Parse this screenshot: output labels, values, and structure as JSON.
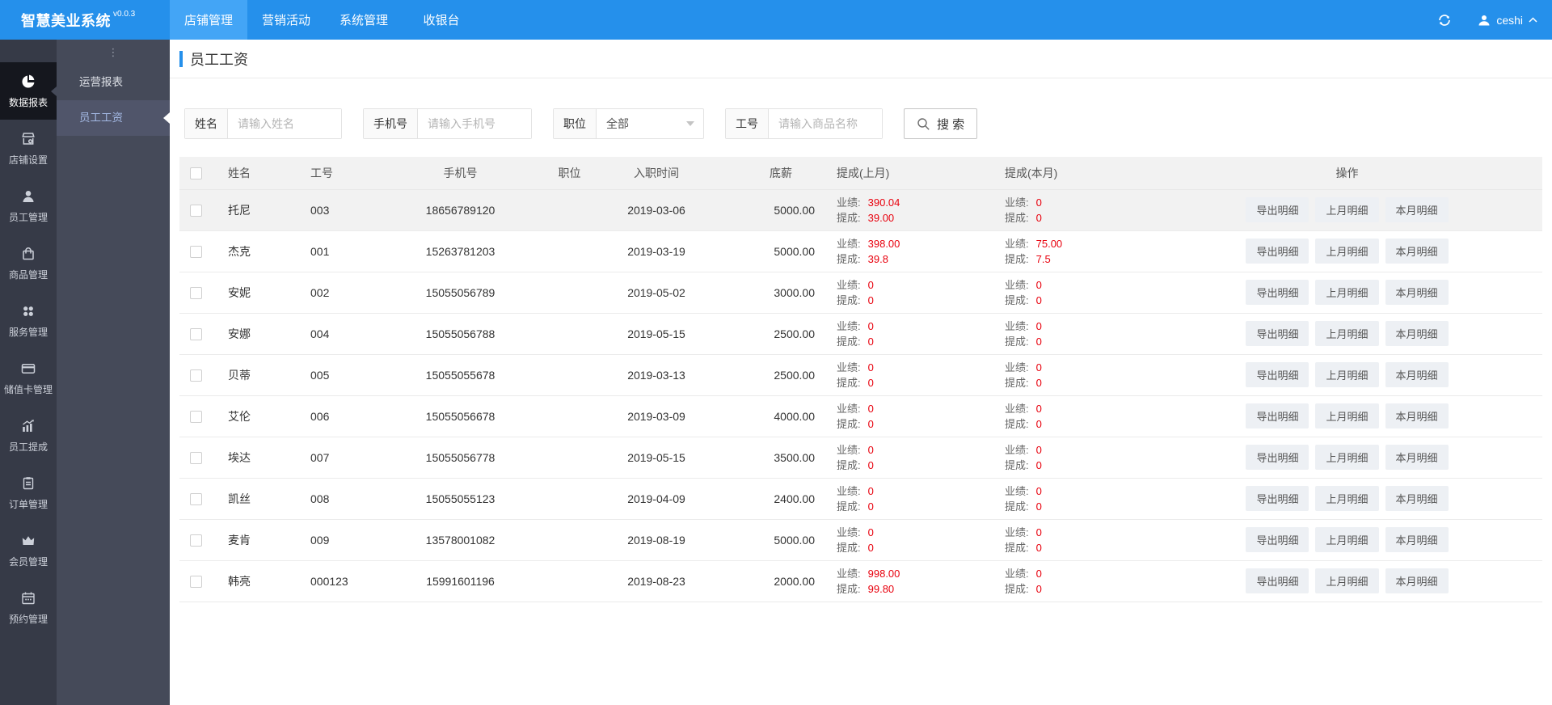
{
  "app": {
    "title": "智慧美业系统",
    "version": "v0.0.3"
  },
  "topnav": {
    "tabs": [
      {
        "label": "店铺管理",
        "slug": "store-management",
        "active": true
      },
      {
        "label": "营销活动",
        "slug": "marketing",
        "active": false
      },
      {
        "label": "系统管理",
        "slug": "system-management",
        "active": false
      },
      {
        "label": "收银台",
        "slug": "cashier",
        "active": false
      }
    ],
    "user": "ceshi"
  },
  "sidebar": {
    "items": [
      {
        "label": "数据报表",
        "icon": "pie-chart-icon",
        "slug": "data-reports",
        "active": true
      },
      {
        "label": "店铺设置",
        "icon": "storefront-icon",
        "slug": "store-settings",
        "active": false
      },
      {
        "label": "员工管理",
        "icon": "staff-icon",
        "slug": "staff-management",
        "active": false
      },
      {
        "label": "商品管理",
        "icon": "shopping-bag-icon",
        "slug": "goods-management",
        "active": false
      },
      {
        "label": "服务管理",
        "icon": "services-icon",
        "slug": "service-management",
        "active": false
      },
      {
        "label": "储值卡管理",
        "icon": "bank-card-icon",
        "slug": "value-card-management",
        "active": false
      },
      {
        "label": "员工提成",
        "icon": "commission-chart-icon",
        "slug": "staff-commission",
        "active": false
      },
      {
        "label": "订单管理",
        "icon": "order-clipboard-icon",
        "slug": "order-management",
        "active": false
      },
      {
        "label": "会员管理",
        "icon": "crown-icon",
        "slug": "member-management",
        "active": false
      },
      {
        "label": "预约管理",
        "icon": "calendar-icon",
        "slug": "appointment-management",
        "active": false
      }
    ]
  },
  "submenu": {
    "items": [
      {
        "label": "运营报表",
        "slug": "operations-report",
        "active": false
      },
      {
        "label": "员工工资",
        "slug": "employee-salary",
        "active": true
      }
    ]
  },
  "page": {
    "title": "员工工资"
  },
  "filters": {
    "name": {
      "label": "姓名",
      "placeholder": "请输入姓名",
      "value": ""
    },
    "phone": {
      "label": "手机号",
      "placeholder": "请输入手机号",
      "value": ""
    },
    "position": {
      "label": "职位",
      "value": "全部"
    },
    "emp_no": {
      "label": "工号",
      "placeholder": "请输入商品名称",
      "value": ""
    },
    "search_label": "搜 索"
  },
  "table": {
    "columns": [
      "姓名",
      "工号",
      "手机号",
      "职位",
      "入职时间",
      "底薪",
      "提成(上月)",
      "提成(本月)",
      "操作"
    ],
    "perf_label": "业绩:",
    "comm_label": "提成:",
    "action_labels": [
      "导出明细",
      "上月明细",
      "本月明细"
    ],
    "rows": [
      {
        "name": "托尼",
        "emp_no": "003",
        "phone": "18656789120",
        "position": "",
        "hire_date": "2019-03-06",
        "base_salary": "5000.00",
        "last_month": {
          "perf": "390.04",
          "comm": "39.00"
        },
        "this_month": {
          "perf": "0",
          "comm": "0"
        },
        "highlighted": true
      },
      {
        "name": "杰克",
        "emp_no": "001",
        "phone": "15263781203",
        "position": "",
        "hire_date": "2019-03-19",
        "base_salary": "5000.00",
        "last_month": {
          "perf": "398.00",
          "comm": "39.8"
        },
        "this_month": {
          "perf": "75.00",
          "comm": "7.5"
        },
        "highlighted": false
      },
      {
        "name": "安妮",
        "emp_no": "002",
        "phone": "15055056789",
        "position": "",
        "hire_date": "2019-05-02",
        "base_salary": "3000.00",
        "last_month": {
          "perf": "0",
          "comm": "0"
        },
        "this_month": {
          "perf": "0",
          "comm": "0"
        },
        "highlighted": false
      },
      {
        "name": "安娜",
        "emp_no": "004",
        "phone": "15055056788",
        "position": "",
        "hire_date": "2019-05-15",
        "base_salary": "2500.00",
        "last_month": {
          "perf": "0",
          "comm": "0"
        },
        "this_month": {
          "perf": "0",
          "comm": "0"
        },
        "highlighted": false
      },
      {
        "name": "贝蒂",
        "emp_no": "005",
        "phone": "15055055678",
        "position": "",
        "hire_date": "2019-03-13",
        "base_salary": "2500.00",
        "last_month": {
          "perf": "0",
          "comm": "0"
        },
        "this_month": {
          "perf": "0",
          "comm": "0"
        },
        "highlighted": false
      },
      {
        "name": "艾伦",
        "emp_no": "006",
        "phone": "15055056678",
        "position": "",
        "hire_date": "2019-03-09",
        "base_salary": "4000.00",
        "last_month": {
          "perf": "0",
          "comm": "0"
        },
        "this_month": {
          "perf": "0",
          "comm": "0"
        },
        "highlighted": false
      },
      {
        "name": "埃达",
        "emp_no": "007",
        "phone": "15055056778",
        "position": "",
        "hire_date": "2019-05-15",
        "base_salary": "3500.00",
        "last_month": {
          "perf": "0",
          "comm": "0"
        },
        "this_month": {
          "perf": "0",
          "comm": "0"
        },
        "highlighted": false
      },
      {
        "name": "凯丝",
        "emp_no": "008",
        "phone": "15055055123",
        "position": "",
        "hire_date": "2019-04-09",
        "base_salary": "2400.00",
        "last_month": {
          "perf": "0",
          "comm": "0"
        },
        "this_month": {
          "perf": "0",
          "comm": "0"
        },
        "highlighted": false
      },
      {
        "name": "麦肯",
        "emp_no": "009",
        "phone": "13578001082",
        "position": "",
        "hire_date": "2019-08-19",
        "base_salary": "5000.00",
        "last_month": {
          "perf": "0",
          "comm": "0"
        },
        "this_month": {
          "perf": "0",
          "comm": "0"
        },
        "highlighted": false
      },
      {
        "name": "韩亮",
        "emp_no": "000123",
        "phone": "15991601196",
        "position": "",
        "hire_date": "2019-08-23",
        "base_salary": "2000.00",
        "last_month": {
          "perf": "998.00",
          "comm": "99.80"
        },
        "this_month": {
          "perf": "0",
          "comm": "0"
        },
        "highlighted": false
      }
    ]
  },
  "colors": {
    "topbar_bg": "#2590EB",
    "topbar_active_tab_bg": "#43A5F6",
    "sidebar_bg": "#363A47",
    "sidebar_active_bg": "#15171E",
    "submenu_bg": "#454A59",
    "submenu_active_bg": "#50556A",
    "submenu_active_text": "#A3B8E3",
    "accent_blue": "#2590EB",
    "value_red": "#E8000D",
    "table_header_bg": "#F2F2F2",
    "row_highlight_bg": "#F2F2F2",
    "button_bg": "#EDF0F4"
  }
}
